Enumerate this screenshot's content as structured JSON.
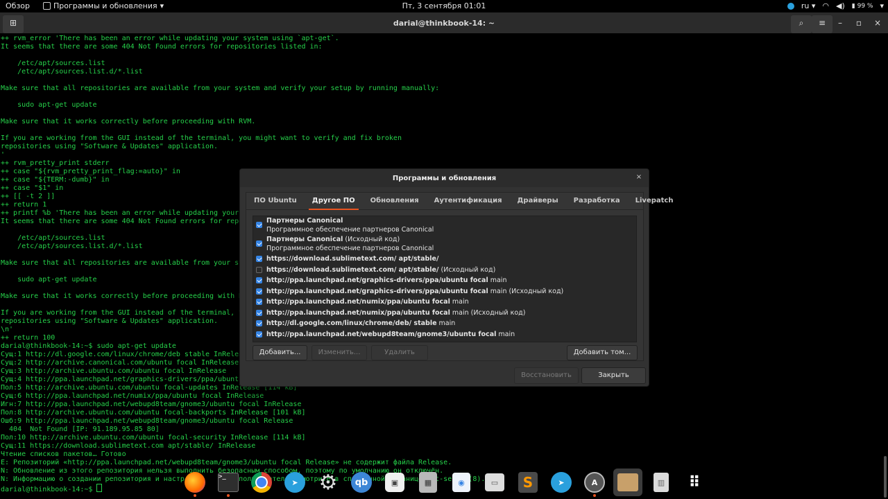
{
  "top_bar": {
    "activities": "Обзор",
    "app_menu": "Программы и обновления",
    "clock": "Пт, 3 сентября  01:01",
    "lang": "ru",
    "battery": "99 %"
  },
  "terminal": {
    "title": "darial@thinkbook-14: ~",
    "lines": [
      "++ rvm_error 'There has been an error while updating your system using `apt-get`.",
      "It seems that there are some 404 Not Found errors for repositories listed in:",
      "",
      "    /etc/apt/sources.list",
      "    /etc/apt/sources.list.d/*.list",
      "",
      "Make sure that all repositories are available from your system and verify your setup by running manually:",
      "",
      "    sudo apt-get update",
      "",
      "Make sure that it works correctly before proceeding with RVM.",
      "",
      "If you are working from the GUI instead of the terminal, you might want to verify and fix broken",
      "repositories using \"Software & Updates\" application.",
      "'",
      "++ rvm_pretty_print stderr",
      "++ case \"${rvm_pretty_print_flag:=auto}\" in",
      "++ case \"${TERM:-dumb}\" in",
      "++ case \"$1\" in",
      "++ [[ -t 2 ]]",
      "++ return 1",
      "++ printf %b 'There has been an error while updating your",
      "It seems that there are some 404 Not Found errors for repo",
      "",
      "    /etc/apt/sources.list",
      "    /etc/apt/sources.list.d/*.list",
      "",
      "Make sure that all repositories are available from your sy",
      "",
      "    sudo apt-get update",
      "",
      "Make sure that it works correctly before proceeding with R",
      "",
      "If you are working from the GUI instead of the terminal, y",
      "repositories using \"Software & Updates\" application.",
      "\\n'",
      "++ return 100",
      "darial@thinkbook-14:~$ sudo apt-get update",
      "Сущ:1 http://dl.google.com/linux/chrome/deb stable InRelease",
      "Сущ:2 http://archive.canonical.com/ubuntu focal InRelease",
      "Сущ:3 http://archive.ubuntu.com/ubuntu focal InRelease",
      "Сущ:4 http://ppa.launchpad.net/graphics-drivers/ppa/ubuntu",
      "Пол:5 http://archive.ubuntu.com/ubuntu focal-updates InRelease [114 kB]",
      "Сущ:6 http://ppa.launchpad.net/numix/ppa/ubuntu focal InRelease",
      "Игн:7 http://ppa.launchpad.net/webupd8team/gnome3/ubuntu focal InRelease",
      "Пол:8 http://archive.ubuntu.com/ubuntu focal-backports InRelease [101 kB]",
      "Ошб:9 http://ppa.launchpad.net/webupd8team/gnome3/ubuntu focal Release",
      "  404  Not Found [IP: 91.189.95.85 80]",
      "Пол:10 http://archive.ubuntu.com/ubuntu focal-security InRelease [114 kB]",
      "Сущ:11 https://download.sublimetext.com apt/stable/ InRelease",
      "Чтение списков пакетов… Готово",
      "E: Репозиторий «http://ppa.launchpad.net/webupd8team/gnome3/ubuntu focal Release» не содержит файла Release.",
      "N: Обновление из этого репозитория нельзя выполнить безопасным способом, поэтому по умолчанию он отключён.",
      "N: Информацию о создании репозитория и настр             пользователей смотрите в справочной странице apt-secure(8)."
    ],
    "prompt": "darial@thinkbook-14:~$ "
  },
  "dialog": {
    "title": "Программы и обновления",
    "tabs": [
      {
        "label": "ПО Ubuntu",
        "active": false
      },
      {
        "label": "Другое ПО",
        "active": true
      },
      {
        "label": "Обновления",
        "active": false
      },
      {
        "label": "Аутентификация",
        "active": false
      },
      {
        "label": "Драйверы",
        "active": false
      },
      {
        "label": "Разработка",
        "active": false
      },
      {
        "label": "Livepatch",
        "active": false
      }
    ],
    "sources": [
      {
        "checked": true,
        "name": "Партнеры Canonical",
        "suffix": "",
        "desc": "Программное обеспечение партнеров Canonical"
      },
      {
        "checked": true,
        "name": "Партнеры Canonical",
        "suffix": " (Исходный код)",
        "desc": "Программное обеспечение партнеров Canonical"
      },
      {
        "checked": true,
        "name": "https://download.sublimetext.com/ apt/stable/",
        "suffix": "",
        "desc": ""
      },
      {
        "checked": false,
        "name": "https://download.sublimetext.com/ apt/stable/",
        "suffix": " (Исходный код)",
        "desc": ""
      },
      {
        "checked": true,
        "name": "http://ppa.launchpad.net/graphics-drivers/ppa/ubuntu focal",
        "suffix": " main",
        "desc": ""
      },
      {
        "checked": true,
        "name": "http://ppa.launchpad.net/graphics-drivers/ppa/ubuntu focal",
        "suffix": " main (Исходный код)",
        "desc": ""
      },
      {
        "checked": true,
        "name": "http://ppa.launchpad.net/numix/ppa/ubuntu focal",
        "suffix": " main",
        "desc": ""
      },
      {
        "checked": true,
        "name": "http://ppa.launchpad.net/numix/ppa/ubuntu focal",
        "suffix": " main (Исходный код)",
        "desc": ""
      },
      {
        "checked": true,
        "name": "http://dl.google.com/linux/chrome/deb/ stable",
        "suffix": " main",
        "desc": ""
      },
      {
        "checked": true,
        "name": "http://ppa.launchpad.net/webupd8team/gnome3/ubuntu focal",
        "suffix": " main",
        "desc": ""
      }
    ],
    "buttons": {
      "add": "Добавить...",
      "edit": "Изменить...",
      "remove": "Удалить",
      "add_volume": "Добавить том...",
      "revert": "Восстановить",
      "close": "Закрыть"
    }
  },
  "dock": {
    "apps": [
      "firefox-icon",
      "terminal-icon",
      "chrome-icon",
      "telegram-icon",
      "settings-icon",
      "qbittorrent-icon",
      "software-icon",
      "calculator-icon",
      "software-store-icon",
      "files-icon",
      "sublime-text-icon",
      "telegram-icon-2",
      "software-updater-icon",
      "archive-manager-icon",
      "trash-icon",
      "show-apps-icon"
    ],
    "qb_label": "qb"
  },
  "colors": {
    "terminal_text": "#26d14a",
    "accent": "#e95420",
    "checkbox": "#3584e4"
  }
}
